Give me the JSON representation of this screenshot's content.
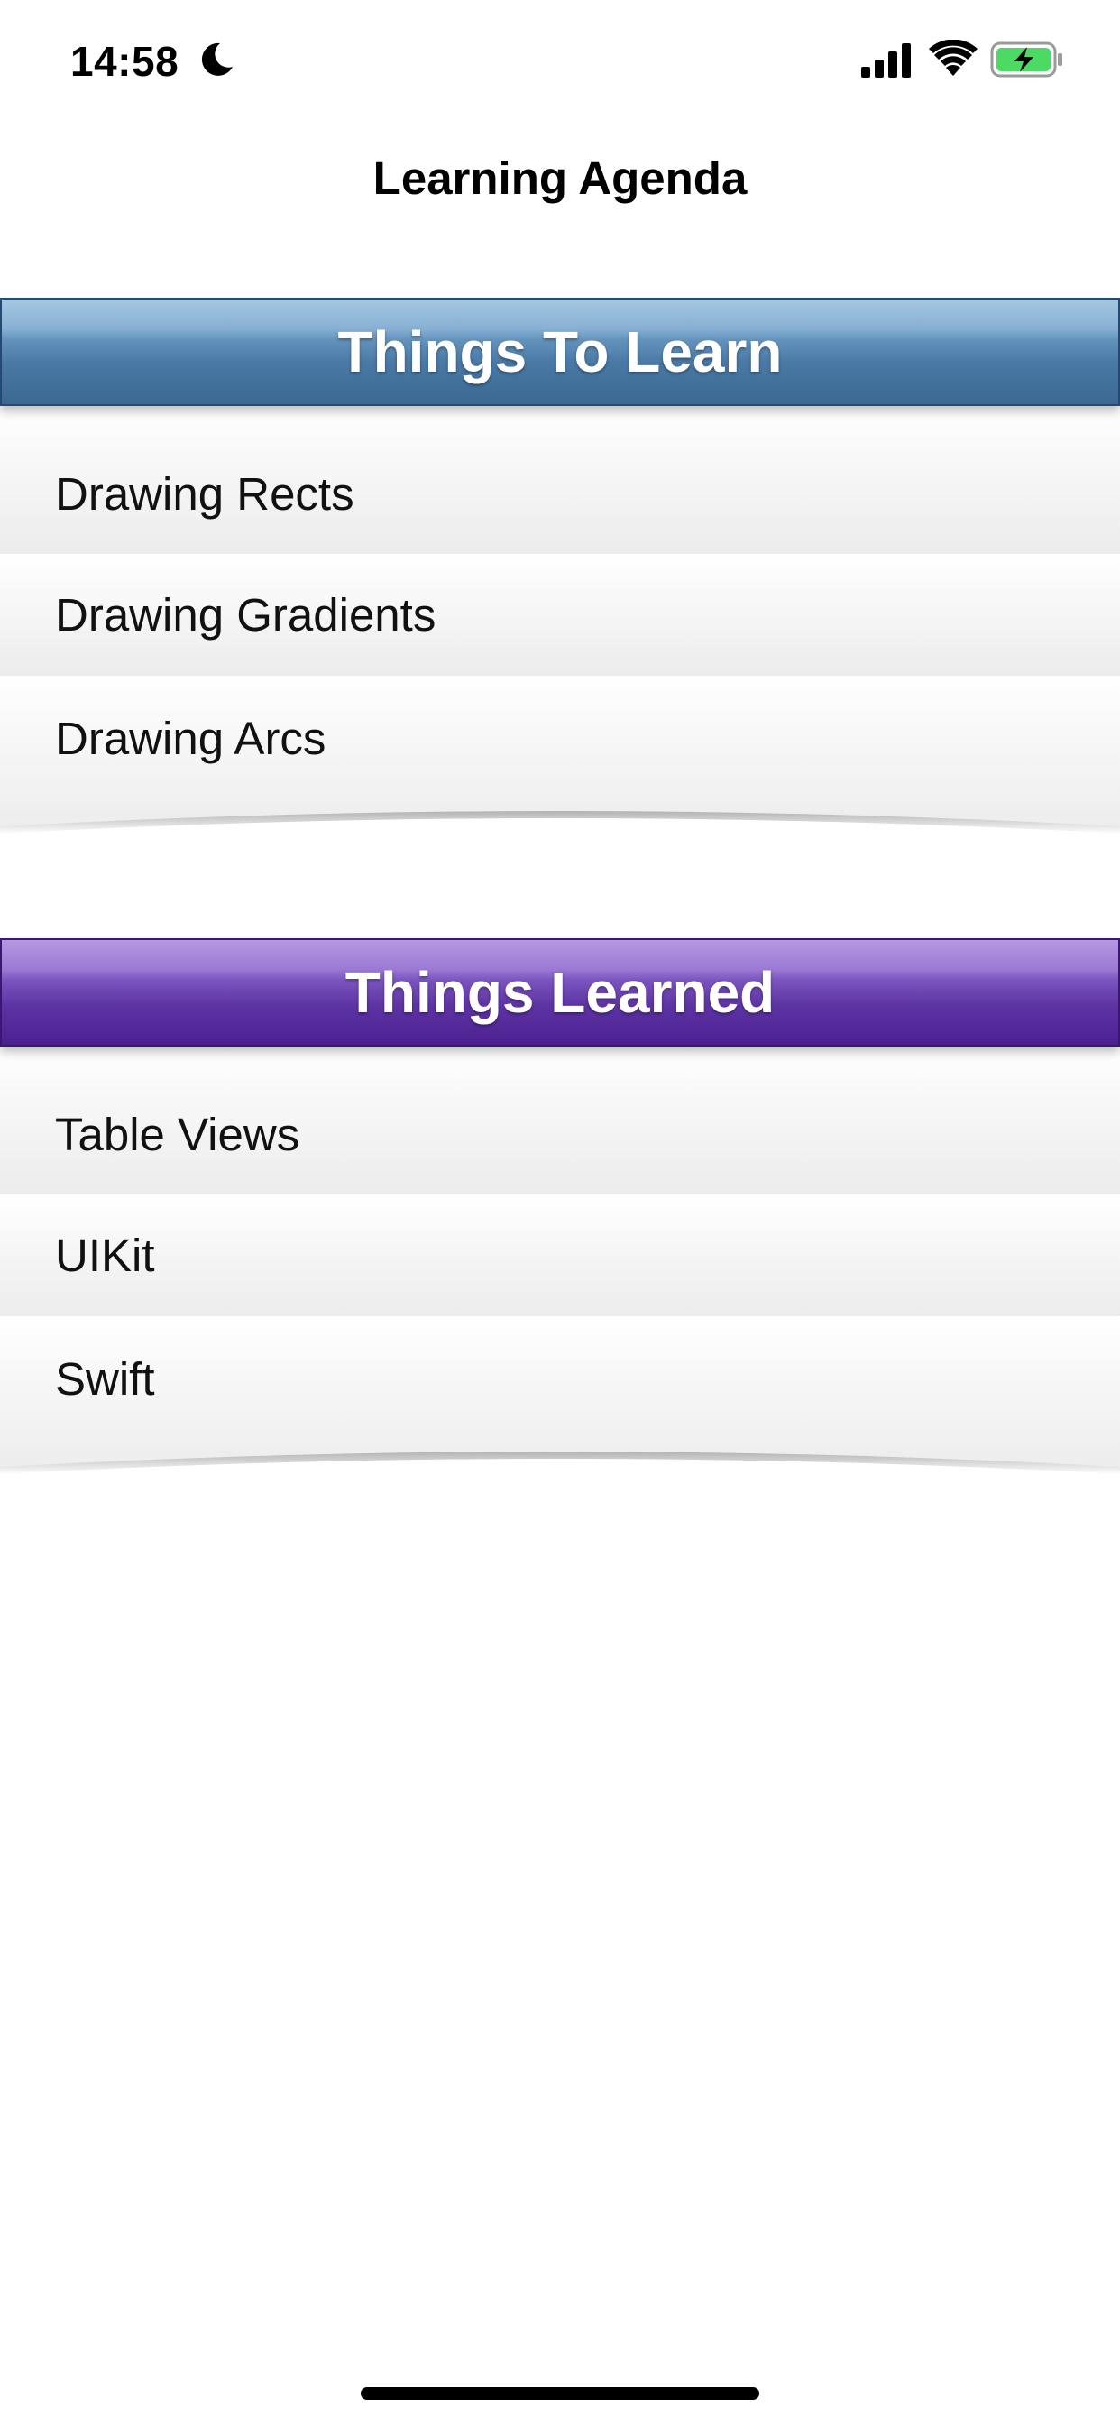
{
  "status_bar": {
    "time": "14:58",
    "focus_icon": "moon-icon",
    "signal_icon": "cellular-signal-icon",
    "wifi_icon": "wifi-icon",
    "battery_icon": "battery-charging-icon",
    "battery_color": "#4cd964"
  },
  "nav": {
    "title": "Learning Agenda"
  },
  "sections": [
    {
      "title": "Things To Learn",
      "accent": "#3b6892",
      "items": [
        "Drawing Rects",
        "Drawing Gradients",
        "Drawing Arcs"
      ]
    },
    {
      "title": "Things Learned",
      "accent": "#4c2090",
      "items": [
        "Table Views",
        "UIKit",
        "Swift"
      ]
    }
  ]
}
